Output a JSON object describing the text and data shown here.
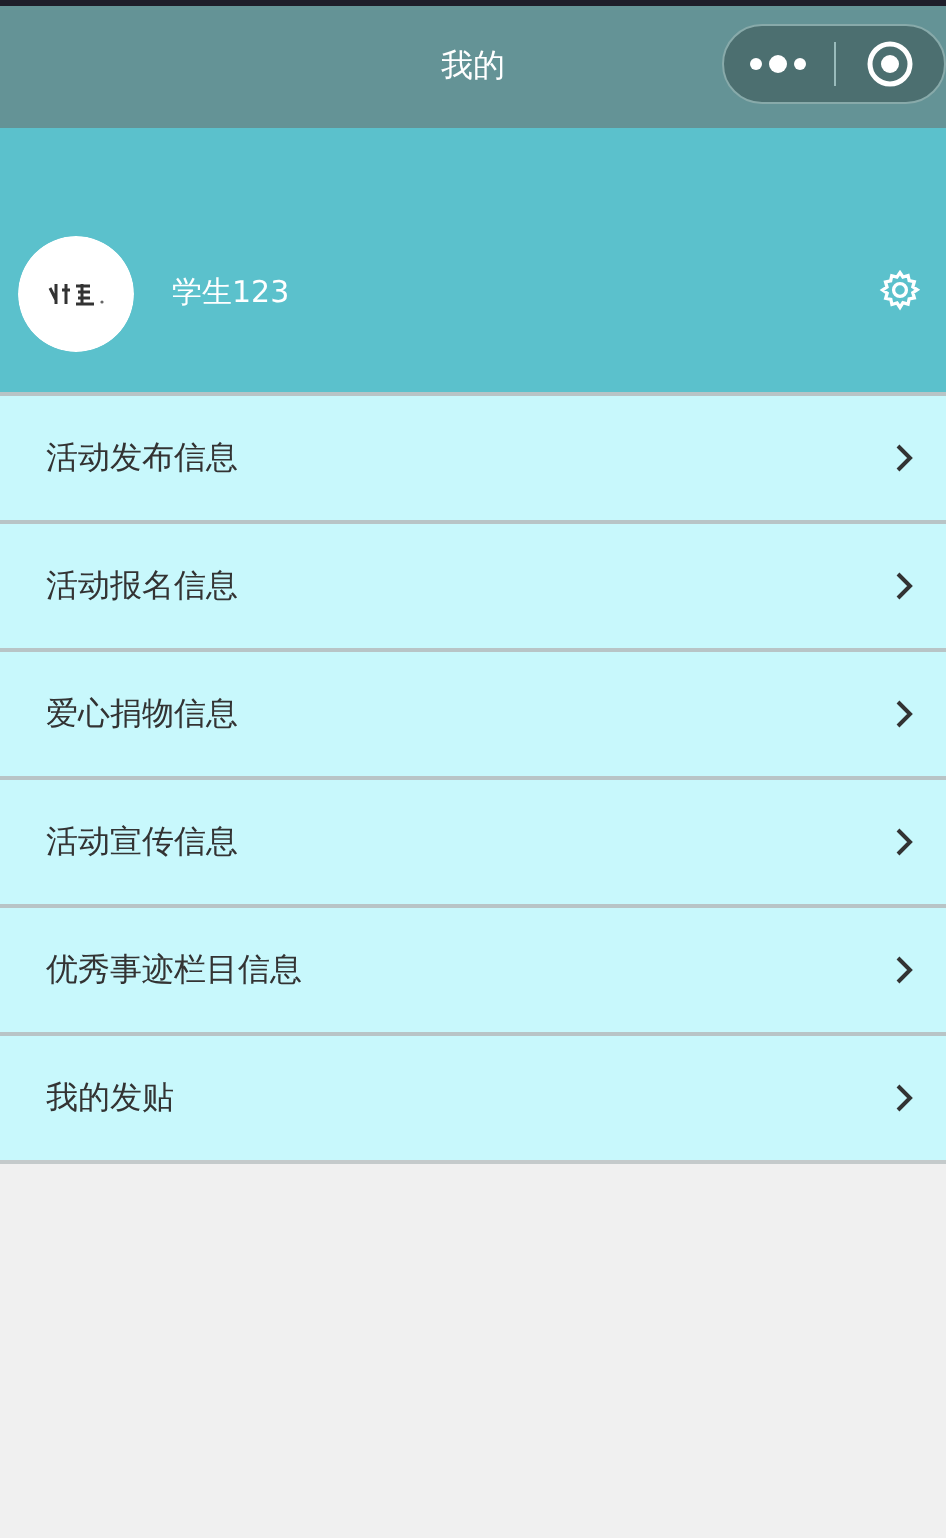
{
  "nav_bar": {
    "title": "我的"
  },
  "profile": {
    "username": "学生123"
  },
  "menu": [
    {
      "label": "活动发布信息"
    },
    {
      "label": "活动报名信息"
    },
    {
      "label": "爱心捐物信息"
    },
    {
      "label": "活动宣传信息"
    },
    {
      "label": "优秀事迹栏目信息"
    },
    {
      "label": "我的发贴"
    }
  ]
}
